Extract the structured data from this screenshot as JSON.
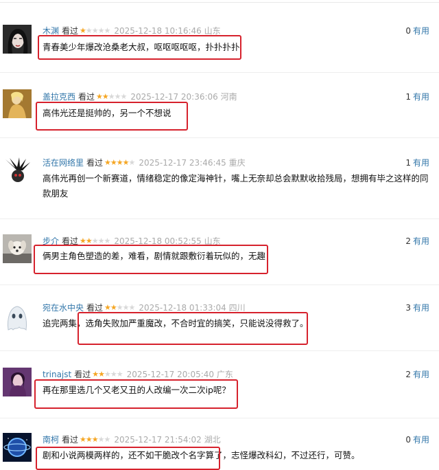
{
  "watched_label": "看过",
  "useful_label": "有用",
  "comments": [
    {
      "user": "木渊",
      "rating": 1,
      "time": "2025-12-18 10:16:46",
      "location": "山东",
      "votes": "0",
      "content": "青春美少年爆改沧桑老大叔，呕呕呕呕呕，扑扑扑扑",
      "avatar": "dark-portrait"
    },
    {
      "user": "盖拉克西",
      "rating": 2,
      "time": "2025-12-17 20:36:06",
      "location": "河南",
      "votes": "1",
      "content": "高伟光还是挺帅的，另一个不想说",
      "avatar": "golden-figure"
    },
    {
      "user": "活在网络里",
      "rating": 4,
      "time": "2025-12-17 23:46:45",
      "location": "重庆",
      "votes": "1",
      "content": "高伟光再创一个新赛道，情绪稳定的像定海神针，嘴上无奈却总会默默收拾残局，想拥有毕之这样的同款朋友",
      "avatar": "spiky-head"
    },
    {
      "user": "步介",
      "rating": 2,
      "time": "2025-12-18 00:52:55",
      "location": "山东",
      "votes": "2",
      "content": "俩男主角色塑造的差，难看，剧情就跟敷衍着玩似的，无趣",
      "avatar": "puppy"
    },
    {
      "user": "宛在水中央",
      "rating": 2,
      "time": "2025-12-18 01:33:04",
      "location": "四川",
      "votes": "3",
      "content": "追完两集，选角失败加严重魔改，不合时宜的搞笑，只能说没得救了。",
      "avatar": "white-ghost"
    },
    {
      "user": "trinajst",
      "rating": 2,
      "time": "2025-12-17 20:05:40",
      "location": "广东",
      "votes": "2",
      "content": "再在那里选几个又老又丑的人改编一次二次ip呢？",
      "avatar": "purple-portrait"
    },
    {
      "user": "南柯",
      "rating": 3,
      "time": "2025-12-17 21:54:02",
      "location": "湖北",
      "votes": "0",
      "content": "剧和小说两模两样的，还不如干脆改个名字算了，志怪爆改科幻，不过还行，可赞。",
      "avatar": "blue-planet"
    }
  ]
}
